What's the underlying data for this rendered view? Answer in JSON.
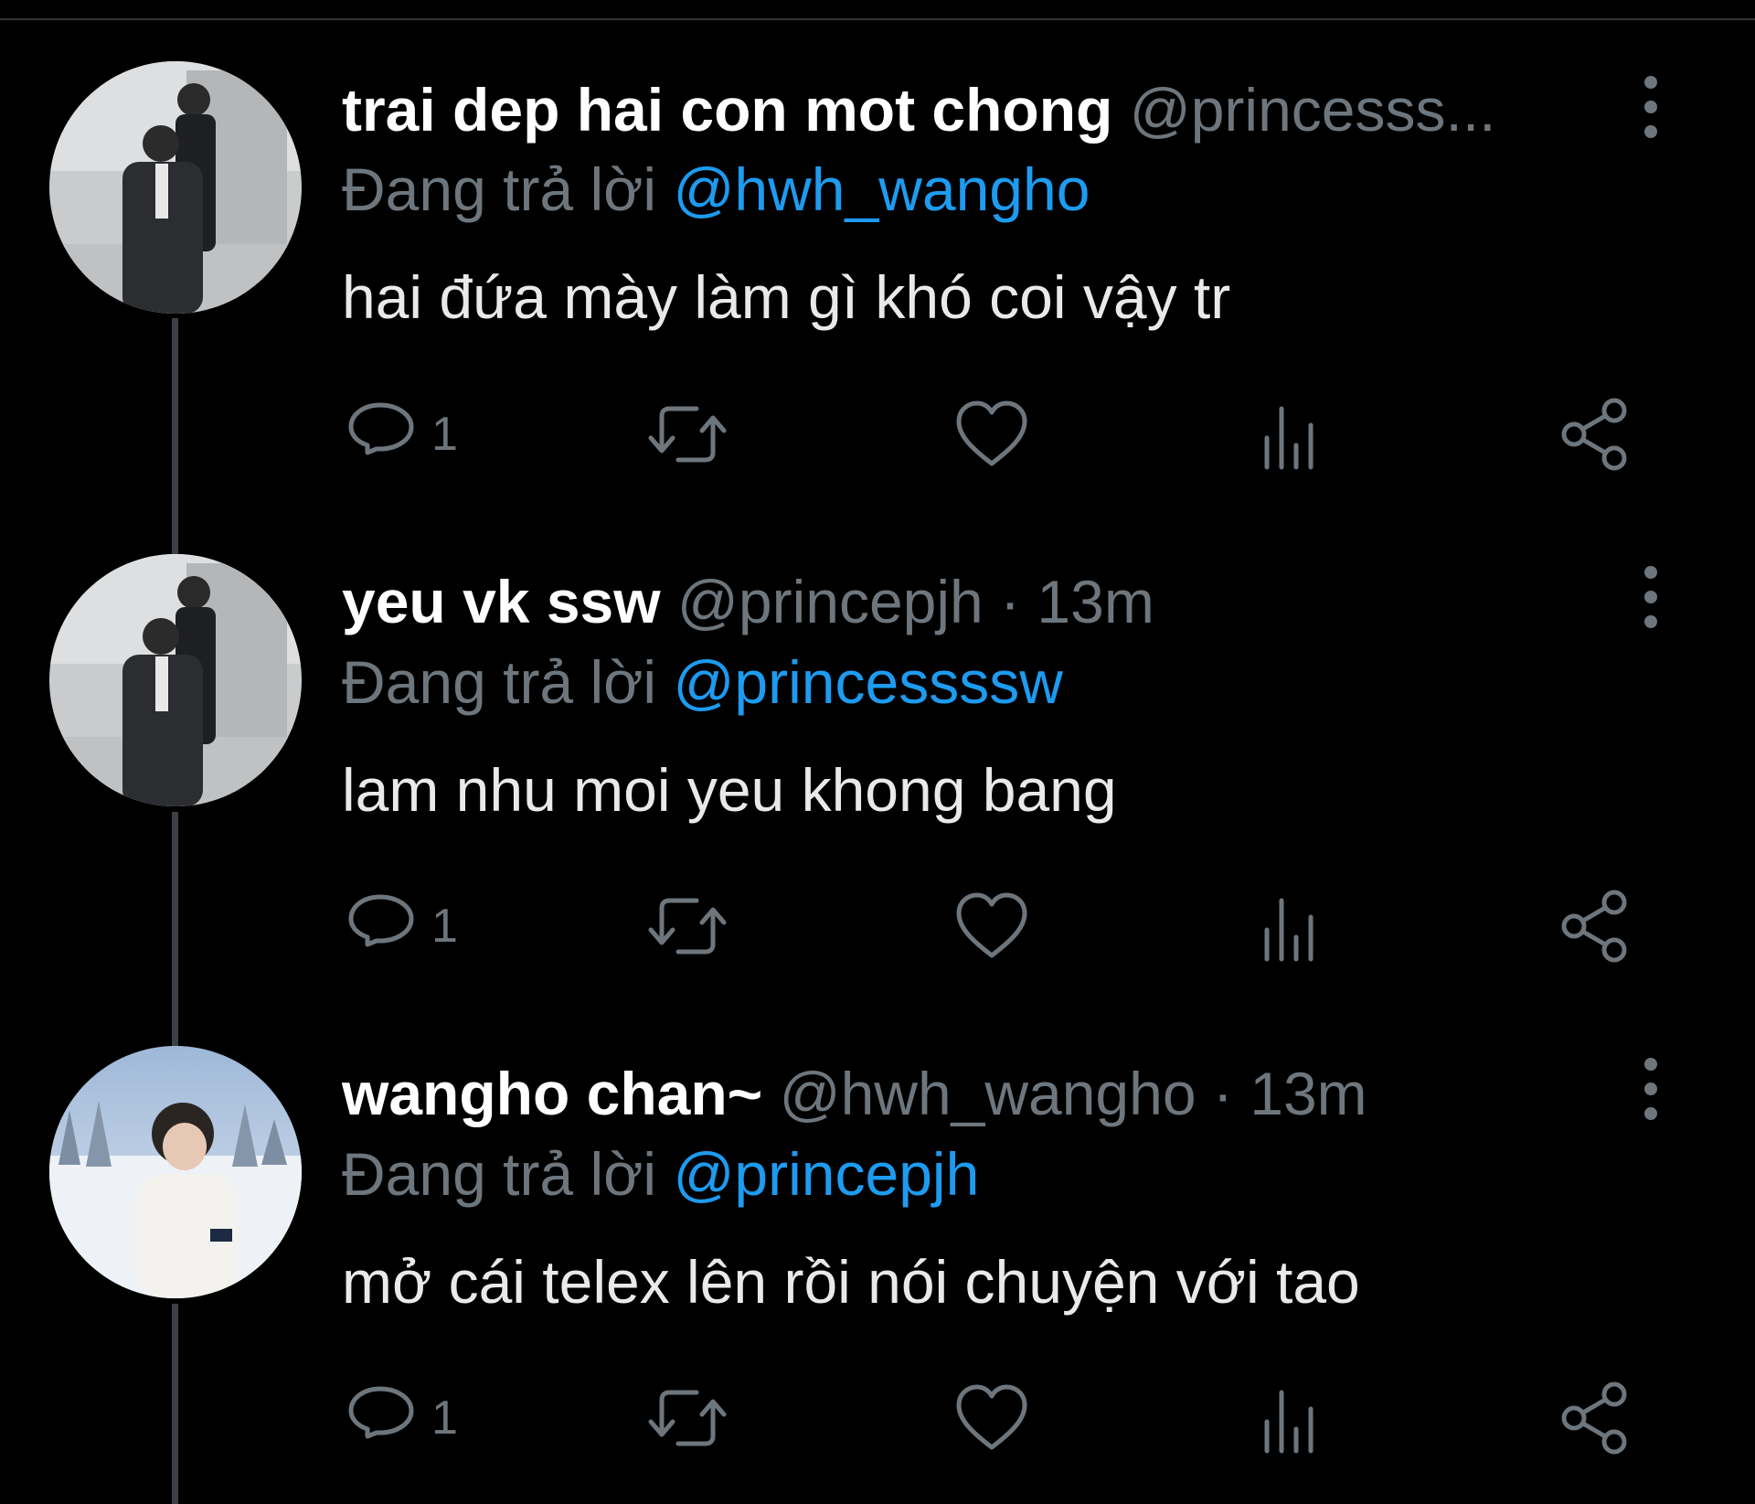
{
  "colors": {
    "background": "#000000",
    "name": "#ffffff",
    "muted": "#6e767d",
    "mention": "#1d9bf0",
    "thread_line": "#3b4046"
  },
  "tweets": [
    {
      "display_name": "trai dep hai con mot chong",
      "handle": "@princesss...",
      "dot": "",
      "time": "",
      "reply_prefix": "Đang trả lời",
      "reply_to": "@hwh_wangho",
      "text": "hai đứa mày làm gì khó coi vậy tr",
      "reply_count": "1",
      "avatar_icon": "avatar-photo-two-men-suits"
    },
    {
      "display_name": "yeu vk ssw",
      "handle": "@princepjh",
      "dot": "·",
      "time": "13m",
      "reply_prefix": "Đang trả lời",
      "reply_to": "@princessssw",
      "text": "lam nhu moi yeu khong bang",
      "reply_count": "1",
      "avatar_icon": "avatar-photo-two-men-suits"
    },
    {
      "display_name": "wangho chan~",
      "handle": "@hwh_wangho",
      "dot": "·",
      "time": "13m",
      "reply_prefix": "Đang trả lời",
      "reply_to": "@princepjh",
      "text": "mở cái telex lên rồi nói chuyện với tao",
      "reply_count": "1",
      "avatar_icon": "avatar-photo-snow-portrait"
    }
  ],
  "icons": {
    "more": "more-vertical-icon",
    "reply": "reply-bubble-icon",
    "retweet": "retweet-icon",
    "like": "heart-icon",
    "views": "analytics-bars-icon",
    "share": "share-icon"
  }
}
